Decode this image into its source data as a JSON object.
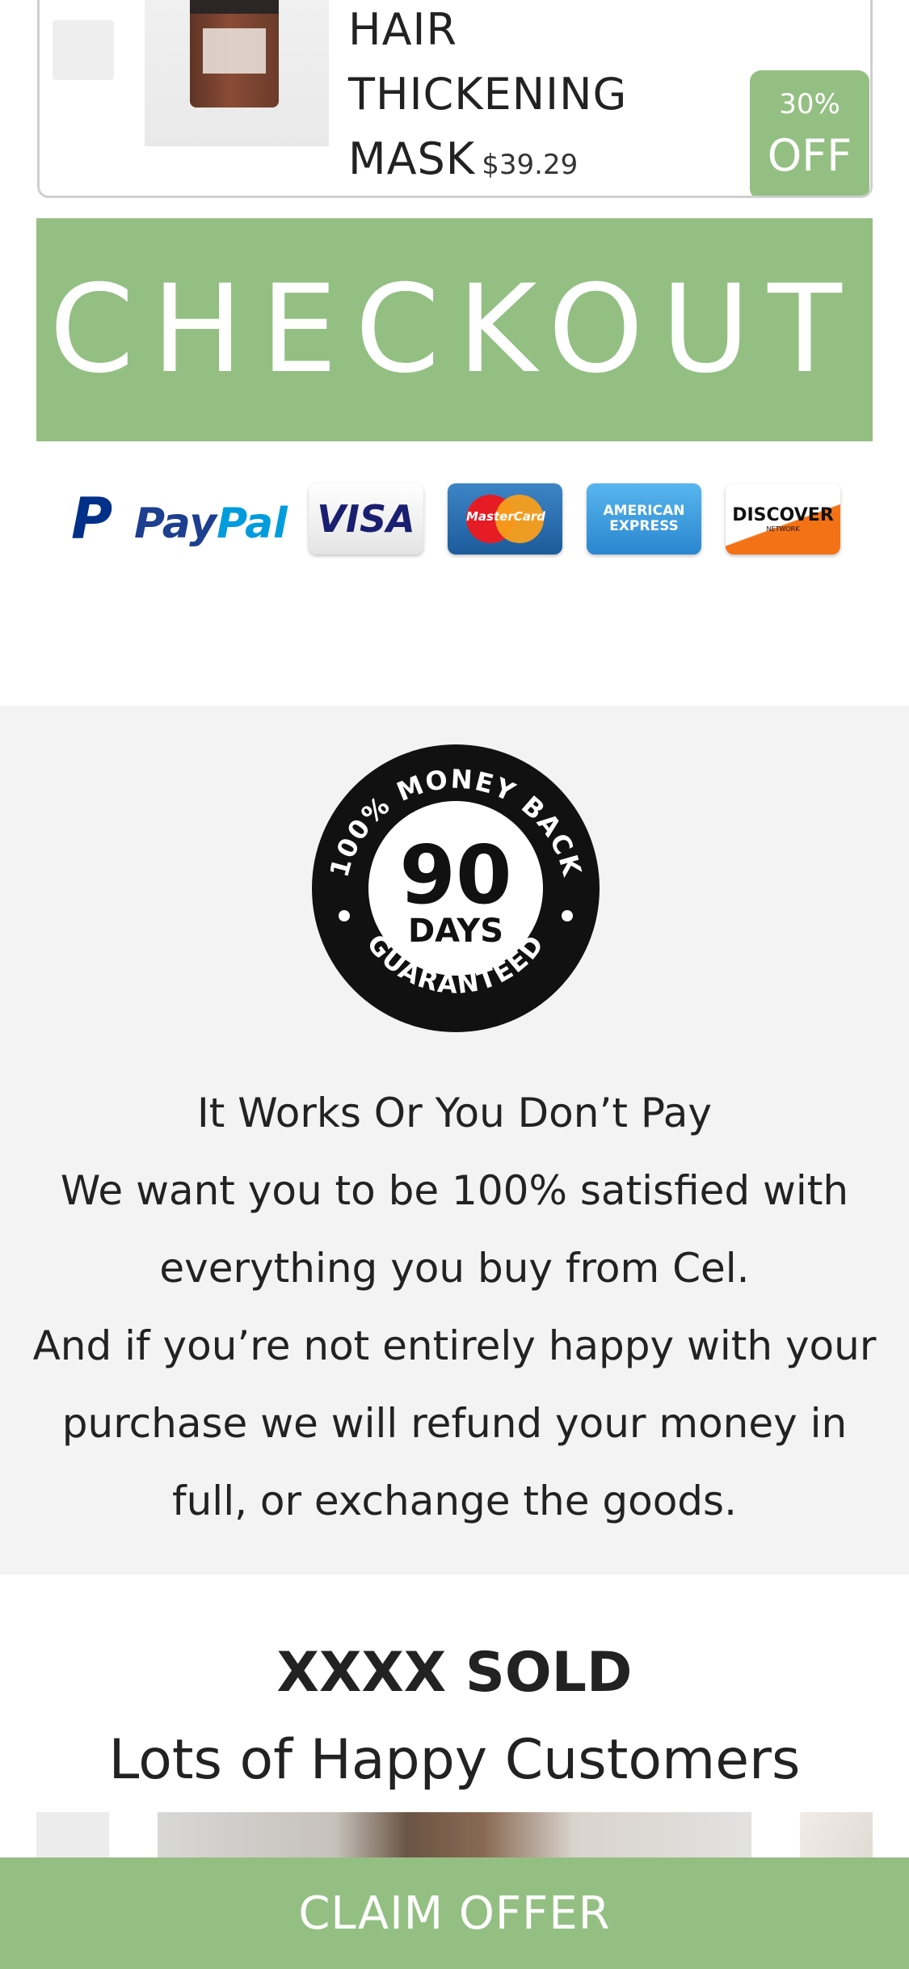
{
  "product": {
    "title_lines": [
      "HAIR",
      "THICKENING",
      "MASK"
    ],
    "price": "$39.29",
    "discount_percent": "30%",
    "discount_label": "OFF"
  },
  "checkout": {
    "label": "CHECKOUT"
  },
  "payment_methods": {
    "paypal_mark": "P",
    "paypal_text_1": "Pay",
    "paypal_text_2": "Pal",
    "visa": "VISA",
    "mastercard": "MasterCard",
    "amex_1": "AMERICAN",
    "amex_2": "EXPRESS",
    "discover": "DISCOVER",
    "discover_sub": "NETWORK"
  },
  "guarantee": {
    "seal_top_text": "100% MONEY BACK",
    "seal_number": "90",
    "seal_days": "DAYS",
    "seal_bottom_text": "GUARANTEED",
    "lines": [
      "It Works Or You Don’t Pay",
      "We want you to be 100% satisfied with",
      "everything you buy from Cel.",
      "And if you’re not entirely happy with your",
      "purchase we will refund your money in",
      "full, or exchange the goods."
    ]
  },
  "social_proof": {
    "title": "XXXX SOLD",
    "subtitle": "Lots of Happy Customers"
  },
  "claim_bar": {
    "label": "CLAIM OFFER"
  },
  "colors": {
    "accent": "#94bf83",
    "section_bg": "#f3f3f3",
    "text": "#222222"
  }
}
